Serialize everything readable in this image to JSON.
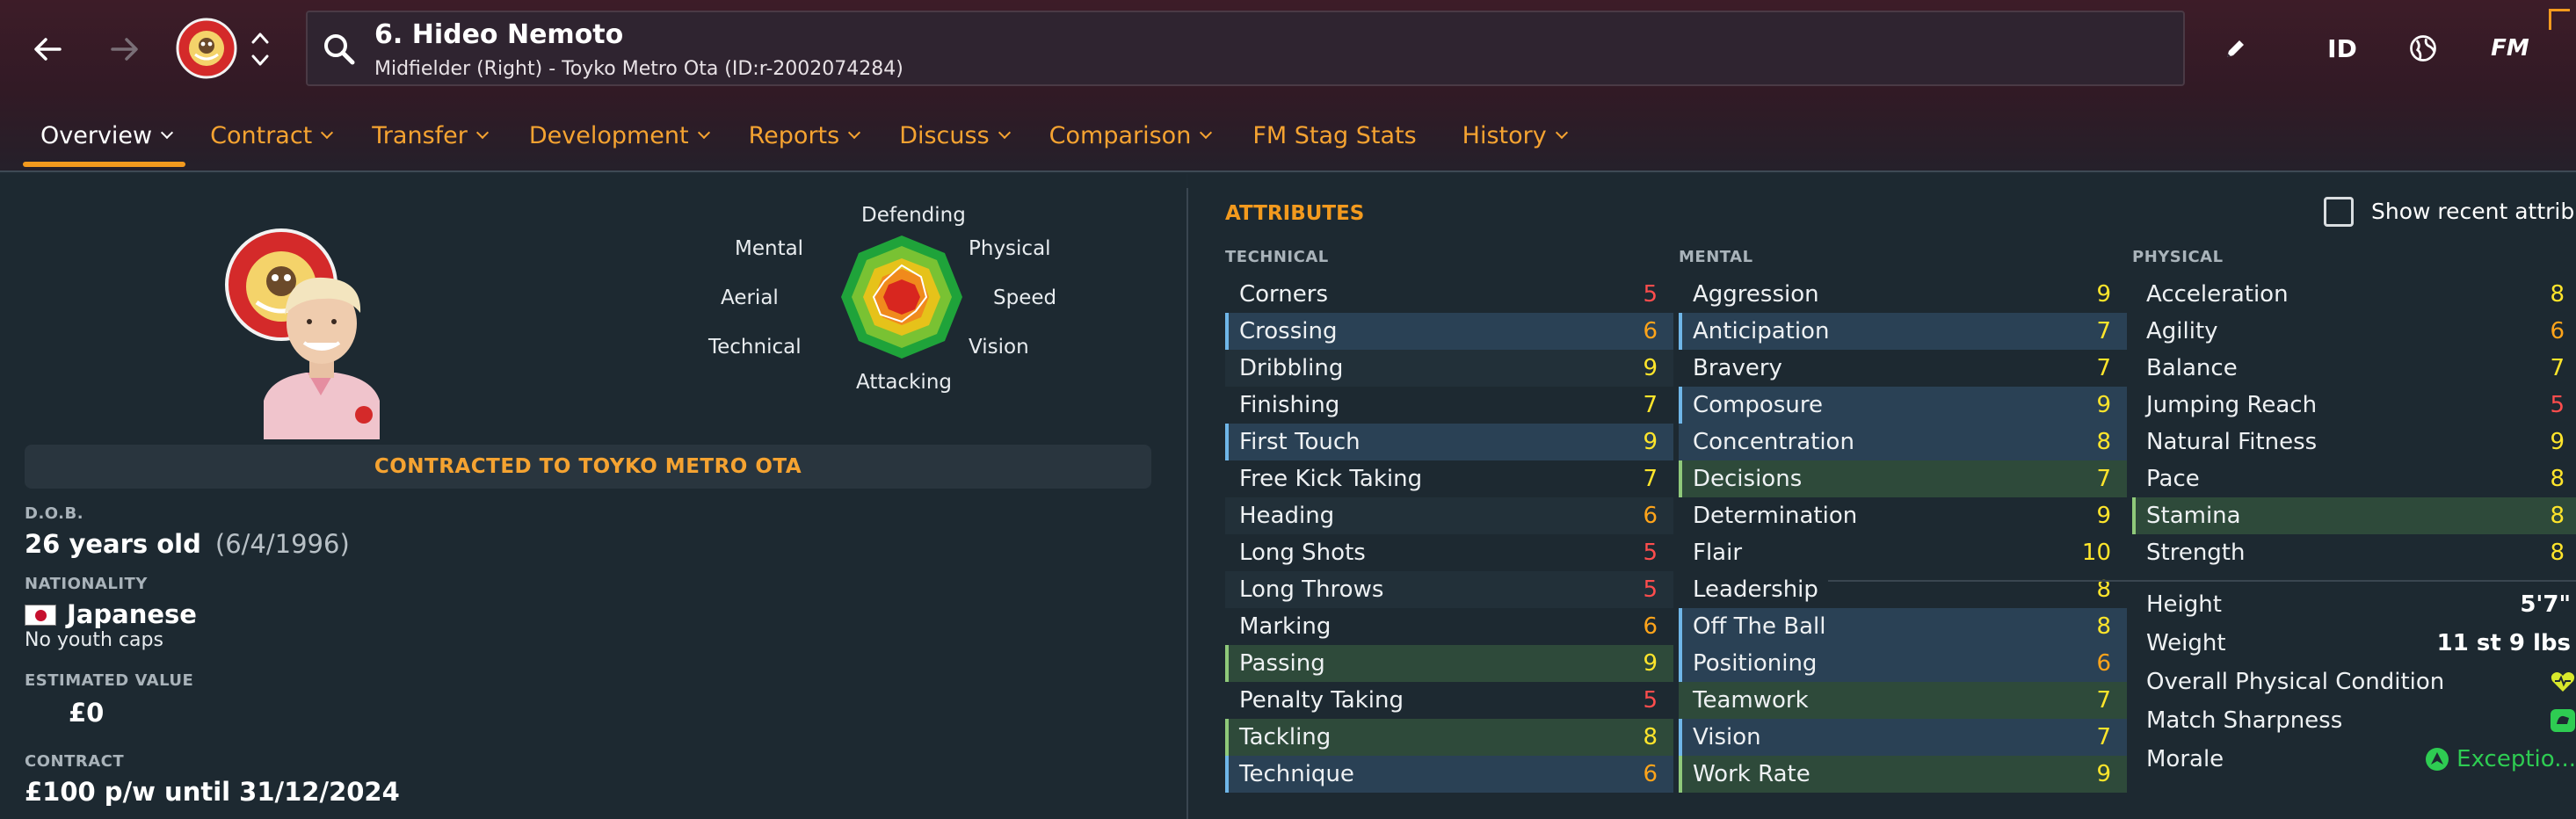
{
  "header": {
    "player_name": "6. Hideo Nemoto",
    "player_subtitle": "Midfielder (Right) - Toyko Metro Ota (ID:r-2002074284)",
    "id_label": "ID",
    "fm_label": "FM"
  },
  "tabs": [
    {
      "label": "Overview",
      "dropdown": true,
      "active": true
    },
    {
      "label": "Contract",
      "dropdown": true
    },
    {
      "label": "Transfer",
      "dropdown": true
    },
    {
      "label": "Development",
      "dropdown": true
    },
    {
      "label": "Reports",
      "dropdown": true
    },
    {
      "label": "Discuss",
      "dropdown": true
    },
    {
      "label": "Comparison",
      "dropdown": true
    },
    {
      "label": "FM Stag Stats",
      "dropdown": false
    },
    {
      "label": "History",
      "dropdown": true
    }
  ],
  "radar": {
    "labels": {
      "top": "Defending",
      "top_right": "Physical",
      "right": "Speed",
      "bottom_right": "Vision",
      "bottom": "Attacking",
      "bottom_left": "Technical",
      "left": "Aerial",
      "top_left": "Mental"
    }
  },
  "profile": {
    "contract_banner": "CONTRACTED TO TOYKO METRO OTA",
    "dob_label": "D.O.B.",
    "age": "26 years old",
    "dob": "(6/4/1996)",
    "nationality_label": "NATIONALITY",
    "nationality": "Japanese",
    "youth_caps": "No youth caps",
    "value_label": "ESTIMATED VALUE",
    "value": "£0",
    "contract_label": "CONTRACT",
    "contract": "£100 p/w until 31/12/2024"
  },
  "attributes": {
    "title": "ATTRIBUTES",
    "show_recent": "Show recent attrib",
    "technical": {
      "heading": "TECHNICAL",
      "rows": [
        {
          "name": "Corners",
          "value": "5"
        },
        {
          "name": "Crossing",
          "value": "6"
        },
        {
          "name": "Dribbling",
          "value": "9"
        },
        {
          "name": "Finishing",
          "value": "7"
        },
        {
          "name": "First Touch",
          "value": "9"
        },
        {
          "name": "Free Kick Taking",
          "value": "7"
        },
        {
          "name": "Heading",
          "value": "6"
        },
        {
          "name": "Long Shots",
          "value": "5"
        },
        {
          "name": "Long Throws",
          "value": "5"
        },
        {
          "name": "Marking",
          "value": "6"
        },
        {
          "name": "Passing",
          "value": "9"
        },
        {
          "name": "Penalty Taking",
          "value": "5"
        },
        {
          "name": "Tackling",
          "value": "8"
        },
        {
          "name": "Technique",
          "value": "6"
        }
      ]
    },
    "mental": {
      "heading": "MENTAL",
      "rows": [
        {
          "name": "Aggression",
          "value": "9"
        },
        {
          "name": "Anticipation",
          "value": "7"
        },
        {
          "name": "Bravery",
          "value": "7"
        },
        {
          "name": "Composure",
          "value": "9"
        },
        {
          "name": "Concentration",
          "value": "8"
        },
        {
          "name": "Decisions",
          "value": "7"
        },
        {
          "name": "Determination",
          "value": "9"
        },
        {
          "name": "Flair",
          "value": "10"
        },
        {
          "name": "Leadership",
          "value": "8"
        },
        {
          "name": "Off The Ball",
          "value": "8"
        },
        {
          "name": "Positioning",
          "value": "6"
        },
        {
          "name": "Teamwork",
          "value": "7"
        },
        {
          "name": "Vision",
          "value": "7"
        },
        {
          "name": "Work Rate",
          "value": "9"
        }
      ]
    },
    "physical": {
      "heading": "PHYSICAL",
      "rows": [
        {
          "name": "Acceleration",
          "value": "8"
        },
        {
          "name": "Agility",
          "value": "6"
        },
        {
          "name": "Balance",
          "value": "7"
        },
        {
          "name": "Jumping Reach",
          "value": "5"
        },
        {
          "name": "Natural Fitness",
          "value": "9"
        },
        {
          "name": "Pace",
          "value": "8"
        },
        {
          "name": "Stamina",
          "value": "8"
        },
        {
          "name": "Strength",
          "value": "8"
        }
      ]
    },
    "physical_extra": {
      "height_label": "Height",
      "height": "5'7\"",
      "weight_label": "Weight",
      "weight": "11 st 9 lbs",
      "condition_label": "Overall Physical Condition",
      "sharpness_label": "Match Sharpness",
      "morale_label": "Morale",
      "morale": "Exceptio..."
    }
  },
  "colors": {
    "accent": "#f39a1e",
    "value_red": "#ff4d4d",
    "value_orange": "#ffa41a",
    "value_yellow": "#ffe52b",
    "morale_green": "#2ecc52"
  }
}
